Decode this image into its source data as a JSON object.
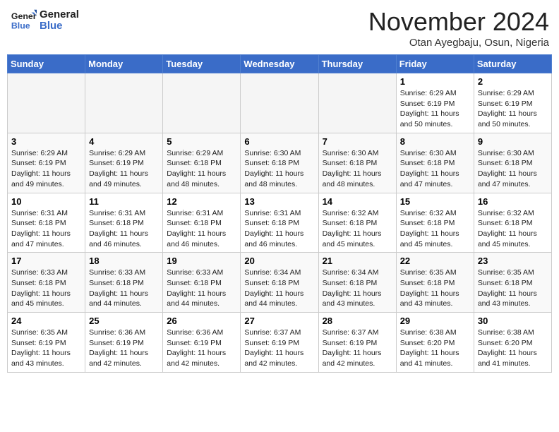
{
  "header": {
    "logo_line1": "General",
    "logo_line2": "Blue",
    "month": "November 2024",
    "location": "Otan Ayegbaju, Osun, Nigeria"
  },
  "weekdays": [
    "Sunday",
    "Monday",
    "Tuesday",
    "Wednesday",
    "Thursday",
    "Friday",
    "Saturday"
  ],
  "weeks": [
    [
      {
        "day": "",
        "info": ""
      },
      {
        "day": "",
        "info": ""
      },
      {
        "day": "",
        "info": ""
      },
      {
        "day": "",
        "info": ""
      },
      {
        "day": "",
        "info": ""
      },
      {
        "day": "1",
        "info": "Sunrise: 6:29 AM\nSunset: 6:19 PM\nDaylight: 11 hours\nand 50 minutes."
      },
      {
        "day": "2",
        "info": "Sunrise: 6:29 AM\nSunset: 6:19 PM\nDaylight: 11 hours\nand 50 minutes."
      }
    ],
    [
      {
        "day": "3",
        "info": "Sunrise: 6:29 AM\nSunset: 6:19 PM\nDaylight: 11 hours\nand 49 minutes."
      },
      {
        "day": "4",
        "info": "Sunrise: 6:29 AM\nSunset: 6:19 PM\nDaylight: 11 hours\nand 49 minutes."
      },
      {
        "day": "5",
        "info": "Sunrise: 6:29 AM\nSunset: 6:18 PM\nDaylight: 11 hours\nand 48 minutes."
      },
      {
        "day": "6",
        "info": "Sunrise: 6:30 AM\nSunset: 6:18 PM\nDaylight: 11 hours\nand 48 minutes."
      },
      {
        "day": "7",
        "info": "Sunrise: 6:30 AM\nSunset: 6:18 PM\nDaylight: 11 hours\nand 48 minutes."
      },
      {
        "day": "8",
        "info": "Sunrise: 6:30 AM\nSunset: 6:18 PM\nDaylight: 11 hours\nand 47 minutes."
      },
      {
        "day": "9",
        "info": "Sunrise: 6:30 AM\nSunset: 6:18 PM\nDaylight: 11 hours\nand 47 minutes."
      }
    ],
    [
      {
        "day": "10",
        "info": "Sunrise: 6:31 AM\nSunset: 6:18 PM\nDaylight: 11 hours\nand 47 minutes."
      },
      {
        "day": "11",
        "info": "Sunrise: 6:31 AM\nSunset: 6:18 PM\nDaylight: 11 hours\nand 46 minutes."
      },
      {
        "day": "12",
        "info": "Sunrise: 6:31 AM\nSunset: 6:18 PM\nDaylight: 11 hours\nand 46 minutes."
      },
      {
        "day": "13",
        "info": "Sunrise: 6:31 AM\nSunset: 6:18 PM\nDaylight: 11 hours\nand 46 minutes."
      },
      {
        "day": "14",
        "info": "Sunrise: 6:32 AM\nSunset: 6:18 PM\nDaylight: 11 hours\nand 45 minutes."
      },
      {
        "day": "15",
        "info": "Sunrise: 6:32 AM\nSunset: 6:18 PM\nDaylight: 11 hours\nand 45 minutes."
      },
      {
        "day": "16",
        "info": "Sunrise: 6:32 AM\nSunset: 6:18 PM\nDaylight: 11 hours\nand 45 minutes."
      }
    ],
    [
      {
        "day": "17",
        "info": "Sunrise: 6:33 AM\nSunset: 6:18 PM\nDaylight: 11 hours\nand 45 minutes."
      },
      {
        "day": "18",
        "info": "Sunrise: 6:33 AM\nSunset: 6:18 PM\nDaylight: 11 hours\nand 44 minutes."
      },
      {
        "day": "19",
        "info": "Sunrise: 6:33 AM\nSunset: 6:18 PM\nDaylight: 11 hours\nand 44 minutes."
      },
      {
        "day": "20",
        "info": "Sunrise: 6:34 AM\nSunset: 6:18 PM\nDaylight: 11 hours\nand 44 minutes."
      },
      {
        "day": "21",
        "info": "Sunrise: 6:34 AM\nSunset: 6:18 PM\nDaylight: 11 hours\nand 43 minutes."
      },
      {
        "day": "22",
        "info": "Sunrise: 6:35 AM\nSunset: 6:18 PM\nDaylight: 11 hours\nand 43 minutes."
      },
      {
        "day": "23",
        "info": "Sunrise: 6:35 AM\nSunset: 6:18 PM\nDaylight: 11 hours\nand 43 minutes."
      }
    ],
    [
      {
        "day": "24",
        "info": "Sunrise: 6:35 AM\nSunset: 6:19 PM\nDaylight: 11 hours\nand 43 minutes."
      },
      {
        "day": "25",
        "info": "Sunrise: 6:36 AM\nSunset: 6:19 PM\nDaylight: 11 hours\nand 42 minutes."
      },
      {
        "day": "26",
        "info": "Sunrise: 6:36 AM\nSunset: 6:19 PM\nDaylight: 11 hours\nand 42 minutes."
      },
      {
        "day": "27",
        "info": "Sunrise: 6:37 AM\nSunset: 6:19 PM\nDaylight: 11 hours\nand 42 minutes."
      },
      {
        "day": "28",
        "info": "Sunrise: 6:37 AM\nSunset: 6:19 PM\nDaylight: 11 hours\nand 42 minutes."
      },
      {
        "day": "29",
        "info": "Sunrise: 6:38 AM\nSunset: 6:20 PM\nDaylight: 11 hours\nand 41 minutes."
      },
      {
        "day": "30",
        "info": "Sunrise: 6:38 AM\nSunset: 6:20 PM\nDaylight: 11 hours\nand 41 minutes."
      }
    ]
  ]
}
